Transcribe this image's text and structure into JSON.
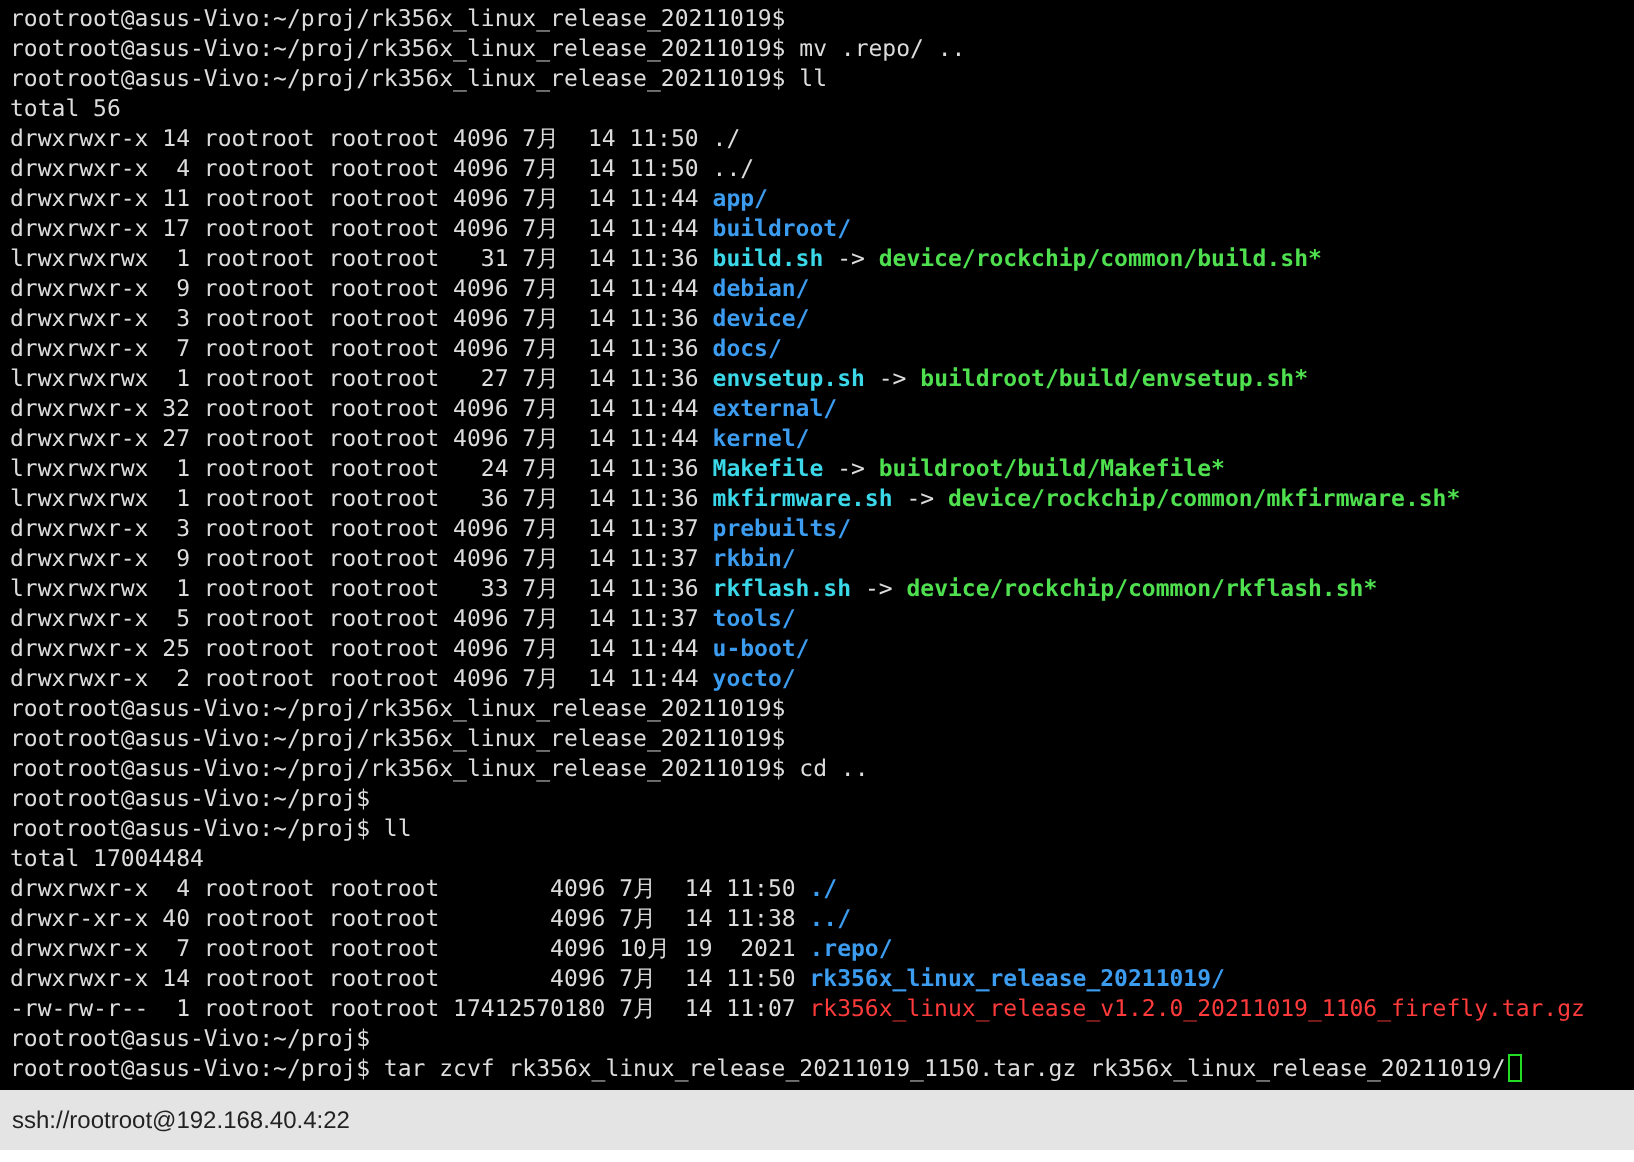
{
  "terminal": {
    "lines": [
      {
        "segments": [
          {
            "text": "rootroot@asus-Vivo:~/proj/rk356x_linux_release_20211019$",
            "kind": "plain"
          }
        ]
      },
      {
        "segments": [
          {
            "text": "rootroot@asus-Vivo:~/proj/rk356x_linux_release_20211019$ mv .repo/ ..",
            "kind": "plain"
          }
        ]
      },
      {
        "segments": [
          {
            "text": "rootroot@asus-Vivo:~/proj/rk356x_linux_release_20211019$ ll",
            "kind": "plain"
          }
        ]
      },
      {
        "segments": [
          {
            "text": "total 56",
            "kind": "plain"
          }
        ]
      },
      {
        "segments": [
          {
            "text": "drwxrwxr-x 14 rootroot rootroot 4096 7月  14 11:50 ",
            "kind": "plain"
          },
          {
            "text": "./",
            "kind": "plain"
          }
        ]
      },
      {
        "segments": [
          {
            "text": "drwxrwxr-x  4 rootroot rootroot 4096 7月  14 11:50 ",
            "kind": "plain"
          },
          {
            "text": "../",
            "kind": "plain"
          }
        ]
      },
      {
        "segments": [
          {
            "text": "drwxrwxr-x 11 rootroot rootroot 4096 7月  14 11:44 ",
            "kind": "plain"
          },
          {
            "text": "app/",
            "kind": "dir"
          }
        ]
      },
      {
        "segments": [
          {
            "text": "drwxrwxr-x 17 rootroot rootroot 4096 7月  14 11:44 ",
            "kind": "plain"
          },
          {
            "text": "buildroot/",
            "kind": "dir"
          }
        ]
      },
      {
        "segments": [
          {
            "text": "lrwxrwxrwx  1 rootroot rootroot   31 7月  14 11:36 ",
            "kind": "plain"
          },
          {
            "text": "build.sh",
            "kind": "link"
          },
          {
            "text": " -> ",
            "kind": "plain"
          },
          {
            "text": "device/rockchip/common/build.sh*",
            "kind": "target"
          }
        ]
      },
      {
        "segments": [
          {
            "text": "drwxrwxr-x  9 rootroot rootroot 4096 7月  14 11:44 ",
            "kind": "plain"
          },
          {
            "text": "debian/",
            "kind": "dir"
          }
        ]
      },
      {
        "segments": [
          {
            "text": "drwxrwxr-x  3 rootroot rootroot 4096 7月  14 11:36 ",
            "kind": "plain"
          },
          {
            "text": "device/",
            "kind": "dir"
          }
        ]
      },
      {
        "segments": [
          {
            "text": "drwxrwxr-x  7 rootroot rootroot 4096 7月  14 11:36 ",
            "kind": "plain"
          },
          {
            "text": "docs/",
            "kind": "dir"
          }
        ]
      },
      {
        "segments": [
          {
            "text": "lrwxrwxrwx  1 rootroot rootroot   27 7月  14 11:36 ",
            "kind": "plain"
          },
          {
            "text": "envsetup.sh",
            "kind": "link"
          },
          {
            "text": " -> ",
            "kind": "plain"
          },
          {
            "text": "buildroot/build/envsetup.sh*",
            "kind": "target"
          }
        ]
      },
      {
        "segments": [
          {
            "text": "drwxrwxr-x 32 rootroot rootroot 4096 7月  14 11:44 ",
            "kind": "plain"
          },
          {
            "text": "external/",
            "kind": "dir"
          }
        ]
      },
      {
        "segments": [
          {
            "text": "drwxrwxr-x 27 rootroot rootroot 4096 7月  14 11:44 ",
            "kind": "plain"
          },
          {
            "text": "kernel/",
            "kind": "dir"
          }
        ]
      },
      {
        "segments": [
          {
            "text": "lrwxrwxrwx  1 rootroot rootroot   24 7月  14 11:36 ",
            "kind": "plain"
          },
          {
            "text": "Makefile",
            "kind": "link"
          },
          {
            "text": " -> ",
            "kind": "plain"
          },
          {
            "text": "buildroot/build/Makefile*",
            "kind": "target"
          }
        ]
      },
      {
        "segments": [
          {
            "text": "lrwxrwxrwx  1 rootroot rootroot   36 7月  14 11:36 ",
            "kind": "plain"
          },
          {
            "text": "mkfirmware.sh",
            "kind": "link"
          },
          {
            "text": " -> ",
            "kind": "plain"
          },
          {
            "text": "device/rockchip/common/mkfirmware.sh*",
            "kind": "target"
          }
        ]
      },
      {
        "segments": [
          {
            "text": "drwxrwxr-x  3 rootroot rootroot 4096 7月  14 11:37 ",
            "kind": "plain"
          },
          {
            "text": "prebuilts/",
            "kind": "dir"
          }
        ]
      },
      {
        "segments": [
          {
            "text": "drwxrwxr-x  9 rootroot rootroot 4096 7月  14 11:37 ",
            "kind": "plain"
          },
          {
            "text": "rkbin/",
            "kind": "dir"
          }
        ]
      },
      {
        "segments": [
          {
            "text": "lrwxrwxrwx  1 rootroot rootroot   33 7月  14 11:36 ",
            "kind": "plain"
          },
          {
            "text": "rkflash.sh",
            "kind": "link"
          },
          {
            "text": " -> ",
            "kind": "plain"
          },
          {
            "text": "device/rockchip/common/rkflash.sh*",
            "kind": "target"
          }
        ]
      },
      {
        "segments": [
          {
            "text": "drwxrwxr-x  5 rootroot rootroot 4096 7月  14 11:37 ",
            "kind": "plain"
          },
          {
            "text": "tools/",
            "kind": "dir"
          }
        ]
      },
      {
        "segments": [
          {
            "text": "drwxrwxr-x 25 rootroot rootroot 4096 7月  14 11:44 ",
            "kind": "plain"
          },
          {
            "text": "u-boot/",
            "kind": "dir"
          }
        ]
      },
      {
        "segments": [
          {
            "text": "drwxrwxr-x  2 rootroot rootroot 4096 7月  14 11:44 ",
            "kind": "plain"
          },
          {
            "text": "yocto/",
            "kind": "dir"
          }
        ]
      },
      {
        "segments": [
          {
            "text": "rootroot@asus-Vivo:~/proj/rk356x_linux_release_20211019$",
            "kind": "plain"
          }
        ]
      },
      {
        "segments": [
          {
            "text": "rootroot@asus-Vivo:~/proj/rk356x_linux_release_20211019$",
            "kind": "plain"
          }
        ]
      },
      {
        "segments": [
          {
            "text": "rootroot@asus-Vivo:~/proj/rk356x_linux_release_20211019$ cd ..",
            "kind": "plain"
          }
        ]
      },
      {
        "segments": [
          {
            "text": "rootroot@asus-Vivo:~/proj$",
            "kind": "plain"
          }
        ]
      },
      {
        "segments": [
          {
            "text": "rootroot@asus-Vivo:~/proj$ ll",
            "kind": "plain"
          }
        ]
      },
      {
        "segments": [
          {
            "text": "total 17004484",
            "kind": "plain"
          }
        ]
      },
      {
        "segments": [
          {
            "text": "drwxrwxr-x  4 rootroot rootroot        4096 7月  14 11:50 ",
            "kind": "plain"
          },
          {
            "text": "./",
            "kind": "dir"
          }
        ]
      },
      {
        "segments": [
          {
            "text": "drwxr-xr-x 40 rootroot rootroot        4096 7月  14 11:38 ",
            "kind": "plain"
          },
          {
            "text": "../",
            "kind": "dir"
          }
        ]
      },
      {
        "segments": [
          {
            "text": "drwxrwxr-x  7 rootroot rootroot        4096 10月 19  2021 ",
            "kind": "plain"
          },
          {
            "text": ".repo/",
            "kind": "dir"
          }
        ]
      },
      {
        "segments": [
          {
            "text": "drwxrwxr-x 14 rootroot rootroot        4096 7月  14 11:50 ",
            "kind": "plain"
          },
          {
            "text": "rk356x_linux_release_20211019/",
            "kind": "dir"
          }
        ]
      },
      {
        "segments": [
          {
            "text": "-rw-rw-r--  1 rootroot rootroot 17412570180 7月  14 11:07 ",
            "kind": "plain"
          },
          {
            "text": "rk356x_linux_release_v1.2.0_20211019_1106_firefly.tar.gz",
            "kind": "archive"
          }
        ]
      },
      {
        "segments": [
          {
            "text": "rootroot@asus-Vivo:~/proj$",
            "kind": "plain"
          }
        ]
      },
      {
        "segments": [
          {
            "text": "rootroot@asus-Vivo:~/proj$ tar zcvf rk356x_linux_release_20211019_1150.tar.gz rk356x_linux_release_20211019/",
            "kind": "plain"
          }
        ],
        "cursor": true
      }
    ]
  },
  "status_bar": {
    "text": "ssh://rootroot@192.168.40.4:22"
  }
}
